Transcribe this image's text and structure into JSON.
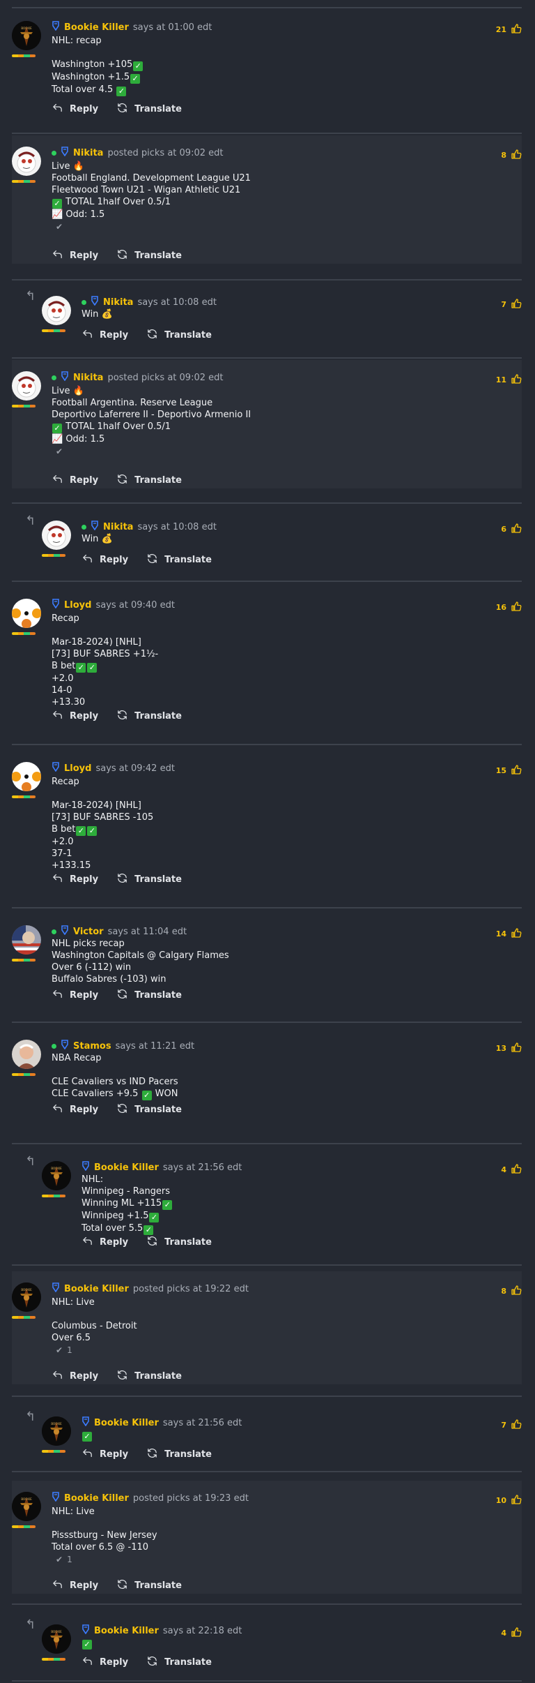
{
  "colors": {
    "background": "#252932",
    "username": "#f6c20a",
    "online": "#2ed15e",
    "check": "#2eac3b"
  },
  "actions": {
    "reply": "Reply",
    "translate": "Translate"
  },
  "comments": [
    {
      "user": "Bookie Killer",
      "verb": "says at 01:00 edt",
      "likes": "21",
      "lines": [
        "NHL: recap",
        "",
        "Washington +105✅",
        "Washington +1.5✅",
        "Total over 4.5 ✅"
      ]
    },
    {
      "user": "Nikita",
      "verb": "posted picks at 09:02 edt",
      "likes": "8",
      "lines": [
        "Live 🔥",
        "Football England. Development League U21",
        "Fleetwood Town U21 - Wigan Athletic U21",
        "✅ TOTAL 1half Over 0.5/1",
        "📈 Odd: 1.5"
      ],
      "tick": ""
    },
    {
      "user": "Nikita",
      "verb": "says at 10:08 edt",
      "likes": "7",
      "lines": [
        "Win 💰"
      ]
    },
    {
      "user": "Nikita",
      "verb": "posted picks at 09:02 edt",
      "likes": "11",
      "lines": [
        "Live 🔥",
        "Football Argentina. Reserve League",
        "Deportivo Laferrere II - Deportivo Armenio II",
        "✅ TOTAL 1half Over 0.5/1",
        "📈 Odd: 1.5"
      ],
      "tick": ""
    },
    {
      "user": "Nikita",
      "verb": "says at 10:08 edt",
      "likes": "6",
      "lines": [
        "Win 💰"
      ]
    },
    {
      "user": "Lloyd",
      "verb": "says at 09:40 edt",
      "likes": "16",
      "lines": [
        "Recap",
        "",
        "Mar-18-2024) [NHL]",
        "[73] BUF SABRES +1½-",
        "B bet✅✅",
        "+2.0",
        "14-0",
        "+13.30"
      ]
    },
    {
      "user": "Lloyd",
      "verb": "says at 09:42 edt",
      "likes": "15",
      "lines": [
        "Recap",
        "",
        "Mar-18-2024) [NHL]",
        "[73] BUF SABRES -105",
        "B bet✅✅",
        "+2.0",
        "37-1",
        "+133.15"
      ]
    },
    {
      "user": "Victor",
      "verb": "says at 11:04 edt",
      "likes": "14",
      "lines": [
        "NHL picks recap",
        "Washington Capitals @ Calgary Flames",
        "Over 6 (-112) win",
        "Buffalo Sabres (-103) win"
      ]
    },
    {
      "user": "Stamos",
      "verb": "says at 11:21 edt",
      "likes": "13",
      "lines": [
        "NBA Recap",
        "",
        "CLE Cavaliers vs IND Pacers",
        "CLE Cavaliers +9.5 ✅ WON"
      ]
    },
    {
      "user": "Bookie Killer",
      "verb": "says at 21:56 edt",
      "likes": "4",
      "lines": [
        "NHL:",
        "Winnipeg - Rangers",
        "Winning ML +115✅",
        "Winnipeg +1.5✅",
        "Total over 5.5✅"
      ]
    },
    {
      "user": "Bookie Killer",
      "verb": "posted picks at 19:22 edt",
      "likes": "8",
      "lines": [
        "NHL: Live",
        "",
        "Columbus - Detroit",
        "Over 6.5"
      ],
      "tick": "1"
    },
    {
      "user": "Bookie Killer",
      "verb": "says at 21:56 edt",
      "likes": "7",
      "lines": [
        "✅"
      ]
    },
    {
      "user": "Bookie Killer",
      "verb": "posted picks at 19:23 edt",
      "likes": "10",
      "lines": [
        "NHL: Live",
        "",
        "Pissstburg - New Jersey",
        "Total over 6.5 @ -110"
      ],
      "tick": "1"
    },
    {
      "user": "Bookie Killer",
      "verb": "says at 22:18 edt",
      "likes": "4",
      "lines": [
        "✅"
      ]
    }
  ]
}
